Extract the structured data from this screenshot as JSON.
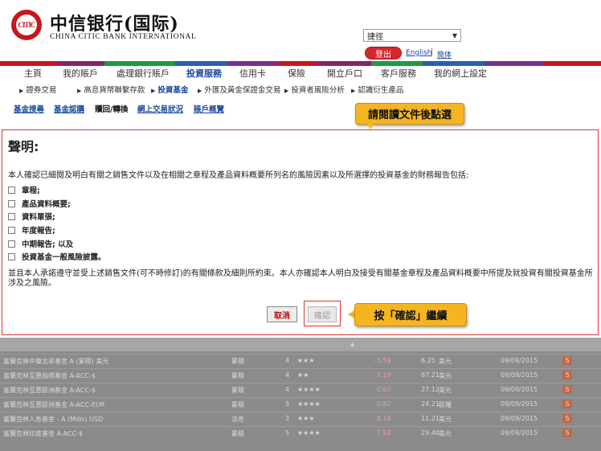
{
  "header": {
    "brand_cn": "中信银行(国际)",
    "brand_en": "CHINA CITIC BANK INTERNATIONAL",
    "logo_text": "CITIC",
    "lang_select_value": "捷徑",
    "logout_label": "登出",
    "english_link": "English",
    "separator": "|",
    "simp_link": "簡体"
  },
  "color_band": [
    "#c8161d",
    "#8c1f6e",
    "#1f9a3c",
    "#2a5fb3",
    "#7a2f8f",
    "#c8161d",
    "#8c1f6e",
    "#1f9a3c",
    "#2a5fb3",
    "#7a2f8f",
    "#c8161d"
  ],
  "main_nav": [
    {
      "label": "主頁"
    },
    {
      "label": "我的賬戶"
    },
    {
      "label": "處理銀行賬戶"
    },
    {
      "label": "投資服務",
      "active": true
    },
    {
      "label": "信用卡"
    },
    {
      "label": "保險"
    },
    {
      "label": "開立戶口"
    },
    {
      "label": "客戶服務"
    },
    {
      "label": "我的網上設定"
    }
  ],
  "sub_nav": [
    {
      "label": "證券交易"
    },
    {
      "label": "高息貨幣聯繫存款"
    },
    {
      "label": "投資基金",
      "active": true
    },
    {
      "label": "外匯及黃金保證金交易"
    },
    {
      "label": "投資者風險分析"
    },
    {
      "label": "認識衍生產品"
    }
  ],
  "tab_links": [
    {
      "label": "基金搜尋"
    },
    {
      "label": "基金認購"
    },
    {
      "label": "贖回/轉換",
      "plain": true
    },
    {
      "label": "網上交易狀況"
    },
    {
      "label": "賬戶概覽"
    }
  ],
  "callouts": {
    "read_docs": "請閱讀文件後點選",
    "press_confirm": "按「確認」繼續"
  },
  "statement": {
    "title": "聲明:",
    "intro": "本人確認已細閱及明白有關之銷售文件以及在相關之章程及產品資料概要所列名的風險因素以及所選擇的投資基金的財務報告包括:",
    "items": [
      "章程;",
      "產品資料概要;",
      "資料單張;",
      "年度報告;",
      "中期報告; 以及",
      "投資基金一般風險披露。"
    ],
    "note": "並且本人承諾遵守並受上述銷售文件(可不時修訂)的有關條款及細則所約束。本人亦確認本人明白及接受有關基金章程及產品資料概要中所提及就投資有關投資基金所涉及之風險。",
    "cancel_label": "取消",
    "confirm_label": "確認"
  },
  "fund_table": {
    "rows": [
      {
        "name": "富蘭克林中東北非基金 A (累積) 美元",
        "dist": "累積",
        "risk": "4",
        "stars": "★★★",
        "ret": "-5.59",
        "price": "6.25",
        "ccy": "美元",
        "date": "09/09/2015",
        "action": "S"
      },
      {
        "name": "富蘭克林互惠指標基金 A-ACC-$",
        "dist": "累積",
        "risk": "4",
        "stars": "★★",
        "ret": "-5.19",
        "price": "87.21",
        "ccy": "美元",
        "date": "09/09/2015",
        "action": "S"
      },
      {
        "name": "富蘭克林互惠歐洲基金 A-ACC-$",
        "dist": "累積",
        "risk": "4",
        "stars": "★★★★",
        "ret": "-0.62",
        "price": "27.12",
        "ccy": "美元",
        "date": "09/09/2015",
        "action": "S"
      },
      {
        "name": "富蘭克林互惠歐洲基金 A-ACC-EUR",
        "dist": "累積",
        "risk": "5",
        "stars": "★★★★",
        "ret": "-0.82",
        "price": "24.21",
        "ccy": "歐羅",
        "date": "09/09/2015",
        "action": "S"
      },
      {
        "name": "富蘭克林入息基金 - A (Mdis) USD",
        "dist": "派息",
        "risk": "3",
        "stars": "★★★",
        "ret": "-8.18",
        "price": "11.21",
        "ccy": "美元",
        "date": "09/09/2015",
        "action": "S"
      },
      {
        "name": "富蘭克林印度基金 A-ACC-$",
        "dist": "累積",
        "risk": "5",
        "stars": "★★★★",
        "ret": "-7.52",
        "price": "29.40",
        "ccy": "美元",
        "date": "09/09/2015",
        "action": "S"
      }
    ]
  }
}
